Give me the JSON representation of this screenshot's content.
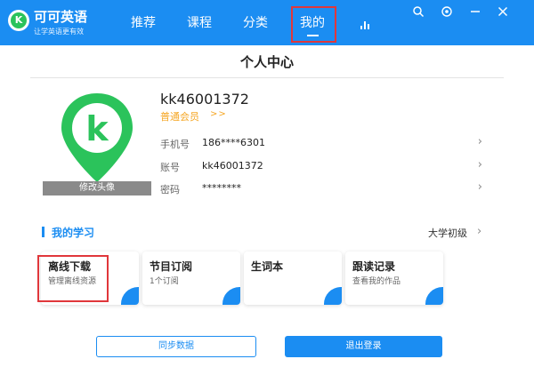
{
  "header": {
    "brand_name": "可可英语",
    "brand_sub": "让学英语更有效",
    "logo_letter": "K",
    "nav": [
      {
        "label": "推荐"
      },
      {
        "label": "课程"
      },
      {
        "label": "分类"
      },
      {
        "label": "我的"
      }
    ],
    "active_nav": "我的",
    "window_icons": [
      "search-icon",
      "settings-icon",
      "minimize-icon",
      "close-icon"
    ]
  },
  "page": {
    "title": "个人中心"
  },
  "profile": {
    "avatar_letter": "k",
    "avatar_edit_label": "修改头像",
    "username": "kk46001372",
    "membership": "普通会员",
    "membership_arrow": ">>",
    "rows": [
      {
        "label": "手机号",
        "value": "186****6301"
      },
      {
        "label": "账号",
        "value": "kk46001372"
      },
      {
        "label": "密码",
        "value": "********"
      }
    ]
  },
  "learning": {
    "section_title": "我的学习",
    "level": "大学初级",
    "cards": [
      {
        "title": "离线下载",
        "subtitle": "管理离线资源"
      },
      {
        "title": "节目订阅",
        "subtitle": "1个订阅"
      },
      {
        "title": "生词本",
        "subtitle": ""
      },
      {
        "title": "跟读记录",
        "subtitle": "查看我的作品"
      }
    ]
  },
  "actions": {
    "sync_label": "同步数据",
    "logout_label": "退出登录"
  },
  "colors": {
    "accent": "#1b8df2",
    "brand_green": "#2bc35b",
    "member_gold": "#f5a623",
    "highlight_red": "#e0373b"
  }
}
